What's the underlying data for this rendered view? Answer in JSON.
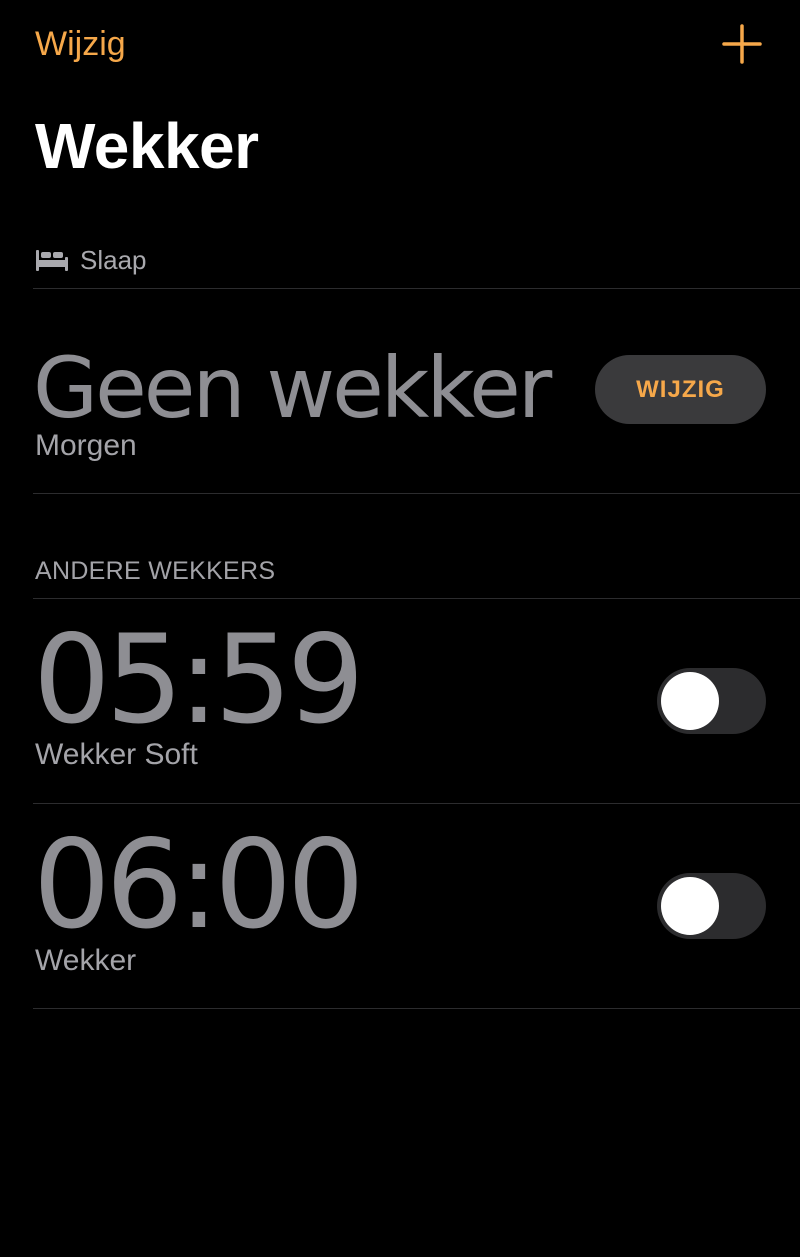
{
  "nav": {
    "edit_label": "Wijzig",
    "add_icon": "plus-icon",
    "accent_color": "#f6a84a"
  },
  "page": {
    "title": "Wekker"
  },
  "sleep": {
    "icon": "bed-icon",
    "label": "Slaap",
    "status": "Geen wekker",
    "day": "Morgen",
    "edit_button_label": "WIJZIG"
  },
  "other_alarms": {
    "header": "ANDERE WEKKERS",
    "items": [
      {
        "time": "05:59",
        "label": "Wekker Soft",
        "enabled": false
      },
      {
        "time": "06:00",
        "label": "Wekker",
        "enabled": false
      }
    ]
  }
}
